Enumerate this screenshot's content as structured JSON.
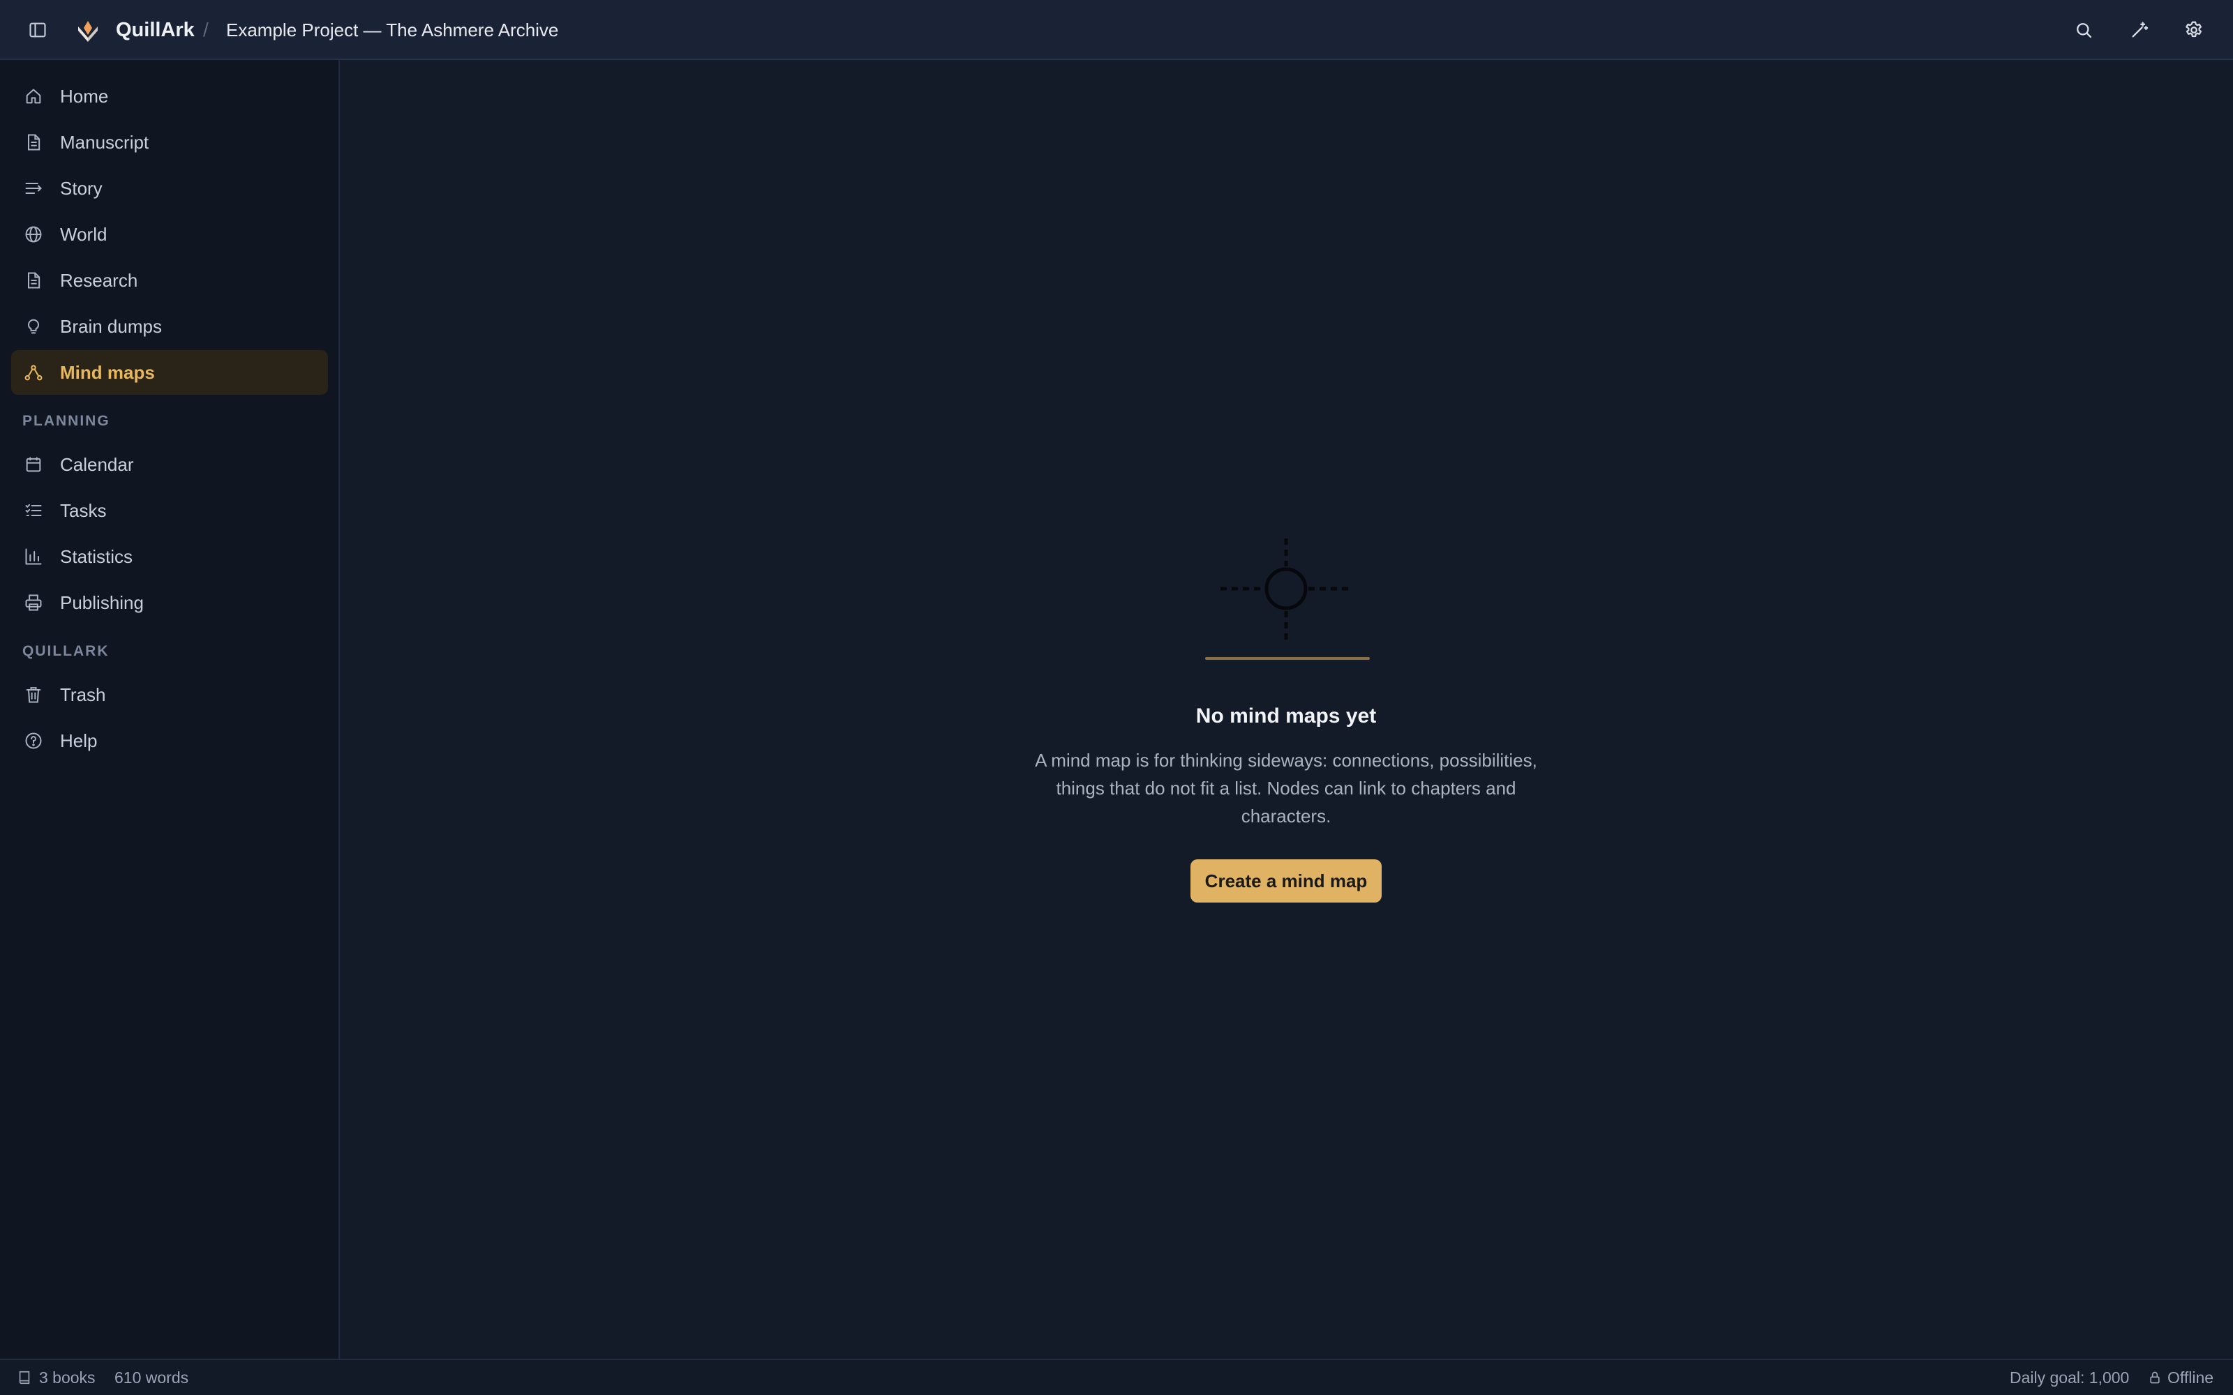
{
  "app": {
    "name": "QuillArk",
    "breadcrumb_separator": "/",
    "project_title": "Example Project — The Ashmere Archive"
  },
  "header": {
    "icons": [
      "sidebar-toggle-icon",
      "search-icon",
      "wand-icon",
      "gear-icon"
    ]
  },
  "sidebar": {
    "items": [
      {
        "label": "Home",
        "icon": "home-icon"
      },
      {
        "label": "Manuscript",
        "icon": "document-icon"
      },
      {
        "label": "Story",
        "icon": "story-lines-icon"
      },
      {
        "label": "World",
        "icon": "globe-icon"
      },
      {
        "label": "Research",
        "icon": "document-icon"
      },
      {
        "label": "Brain dumps",
        "icon": "lightbulb-icon"
      },
      {
        "label": "Mind maps",
        "icon": "mind-map-icon",
        "active": true
      }
    ],
    "planning_heading": "PLANNING",
    "planning_items": [
      {
        "label": "Calendar",
        "icon": "calendar-icon"
      },
      {
        "label": "Tasks",
        "icon": "tasks-icon"
      },
      {
        "label": "Statistics",
        "icon": "bar-chart-icon"
      },
      {
        "label": "Publishing",
        "icon": "printer-icon"
      }
    ],
    "quillark_heading": "QUILLARK",
    "quillark_items": [
      {
        "label": "Trash",
        "icon": "trash-icon"
      },
      {
        "label": "Help",
        "icon": "help-icon"
      }
    ]
  },
  "empty_state": {
    "title": "No mind maps yet",
    "description": "A mind map is for thinking sideways: connections, possibilities, things that do not fit a list. Nodes can link to chapters and characters.",
    "button_label": "Create a mind map"
  },
  "status_bar": {
    "books": "3 books",
    "words": "610 words",
    "daily_goal": "Daily goal: 1,000",
    "connection": "Offline"
  },
  "colors": {
    "accent": "#dfb264",
    "active_nav_bg": "#2a2418",
    "background": "#131a28",
    "sidebar_bg": "#0f1521",
    "topbar_bg": "#1a2335"
  }
}
